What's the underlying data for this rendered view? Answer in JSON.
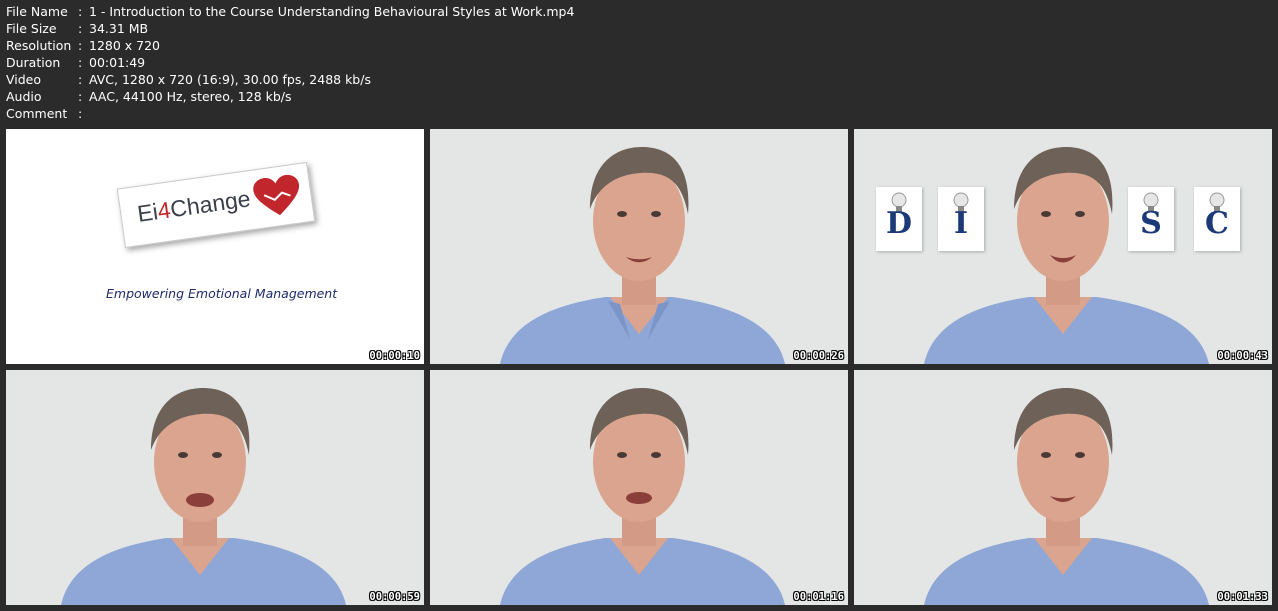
{
  "meta": [
    {
      "key": "File Name",
      "sep": ":",
      "value": "1 - Introduction to the Course Understanding Behavioural Styles at Work.mp4"
    },
    {
      "key": "File Size",
      "sep": ":",
      "value": "34.31 MB"
    },
    {
      "key": "Resolution",
      "sep": ":",
      "value": "1280 x 720"
    },
    {
      "key": "Duration",
      "sep": ":",
      "value": "00:01:49"
    },
    {
      "key": "Video",
      "sep": ":",
      "value": "AVC, 1280 x 720 (16:9), 30.00 fps, 2488 kb/s"
    },
    {
      "key": "Audio",
      "sep": ":",
      "value": "AAC, 44100 Hz, stereo, 128 kb/s"
    },
    {
      "key": "Comment",
      "sep": ":",
      "value": ""
    }
  ],
  "thumbnails": [
    {
      "timestamp": "00:00:10",
      "logo": {
        "text_a": "Ei",
        "text_b": "4",
        "text_c": "Change",
        "tagline": "Empowering Emotional Management"
      }
    },
    {
      "timestamp": "00:00:26"
    },
    {
      "timestamp": "00:00:43",
      "disc_letters": [
        "D",
        "I",
        "S",
        "C"
      ]
    },
    {
      "timestamp": "00:00:59"
    },
    {
      "timestamp": "00:01:16"
    },
    {
      "timestamp": "00:01:33"
    }
  ],
  "colors": {
    "background": "#2b2b2b",
    "text": "#ffffff",
    "wall": "#e4e6e6",
    "shirt": "#8fa7d6",
    "skin": "#dba48e",
    "hair": "#6e6258",
    "logo_red": "#c0262c",
    "tagline_blue": "#1f2a6b"
  }
}
